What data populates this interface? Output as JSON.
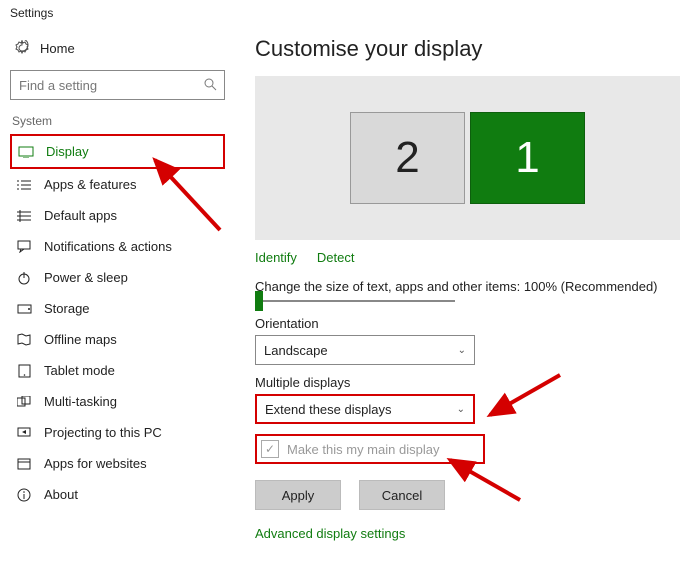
{
  "window": {
    "title": "Settings"
  },
  "sidebar": {
    "home": "Home",
    "search_placeholder": "Find a setting",
    "section": "System",
    "items": [
      {
        "label": "Display",
        "icon": "monitor-icon",
        "active": true
      },
      {
        "label": "Apps & features",
        "icon": "list-icon"
      },
      {
        "label": "Default apps",
        "icon": "grid-icon"
      },
      {
        "label": "Notifications & actions",
        "icon": "message-icon"
      },
      {
        "label": "Power & sleep",
        "icon": "power-icon"
      },
      {
        "label": "Storage",
        "icon": "drive-icon"
      },
      {
        "label": "Offline maps",
        "icon": "map-icon"
      },
      {
        "label": "Tablet mode",
        "icon": "tablet-icon"
      },
      {
        "label": "Multi-tasking",
        "icon": "multitask-icon"
      },
      {
        "label": "Projecting to this PC",
        "icon": "project-icon"
      },
      {
        "label": "Apps for websites",
        "icon": "apps-web-icon"
      },
      {
        "label": "About",
        "icon": "info-icon"
      }
    ]
  },
  "main": {
    "title": "Customise your display",
    "monitors": {
      "secondary": "2",
      "primary": "1"
    },
    "identify": "Identify",
    "detect": "Detect",
    "scaling_text": "Change the size of text, apps and other items: 100% (Recommended)",
    "orientation_label": "Orientation",
    "orientation_value": "Landscape",
    "multiple_label": "Multiple displays",
    "multiple_value": "Extend these displays",
    "make_main": "Make this my main display",
    "apply": "Apply",
    "cancel": "Cancel",
    "advanced": "Advanced display settings"
  }
}
